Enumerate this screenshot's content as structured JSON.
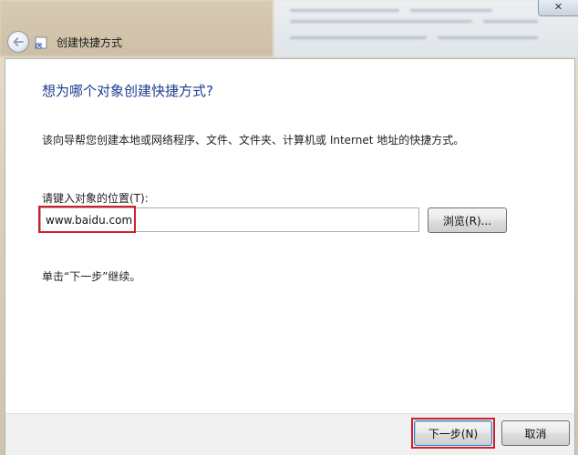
{
  "window": {
    "title": "创建快捷方式",
    "close_glyph": "✕",
    "back_icon": "back-arrow-icon",
    "app_icon": "shortcut-icon"
  },
  "page": {
    "main_instruction": "想为哪个对象创建快捷方式?",
    "description": "该向导帮您创建本地或网络程序、文件、文件夹、计算机或 Internet 地址的快捷方式。",
    "location_label": "请键入对象的位置(T):",
    "location_value": "www.baidu.com",
    "browse_label": "浏览(R)...",
    "continue_hint": "单击“下一步”继续。"
  },
  "footer": {
    "next_label": "下一步(N)",
    "cancel_label": "取消"
  },
  "colors": {
    "instruction": "#1d3d8f",
    "highlight": "#d31f2b"
  }
}
